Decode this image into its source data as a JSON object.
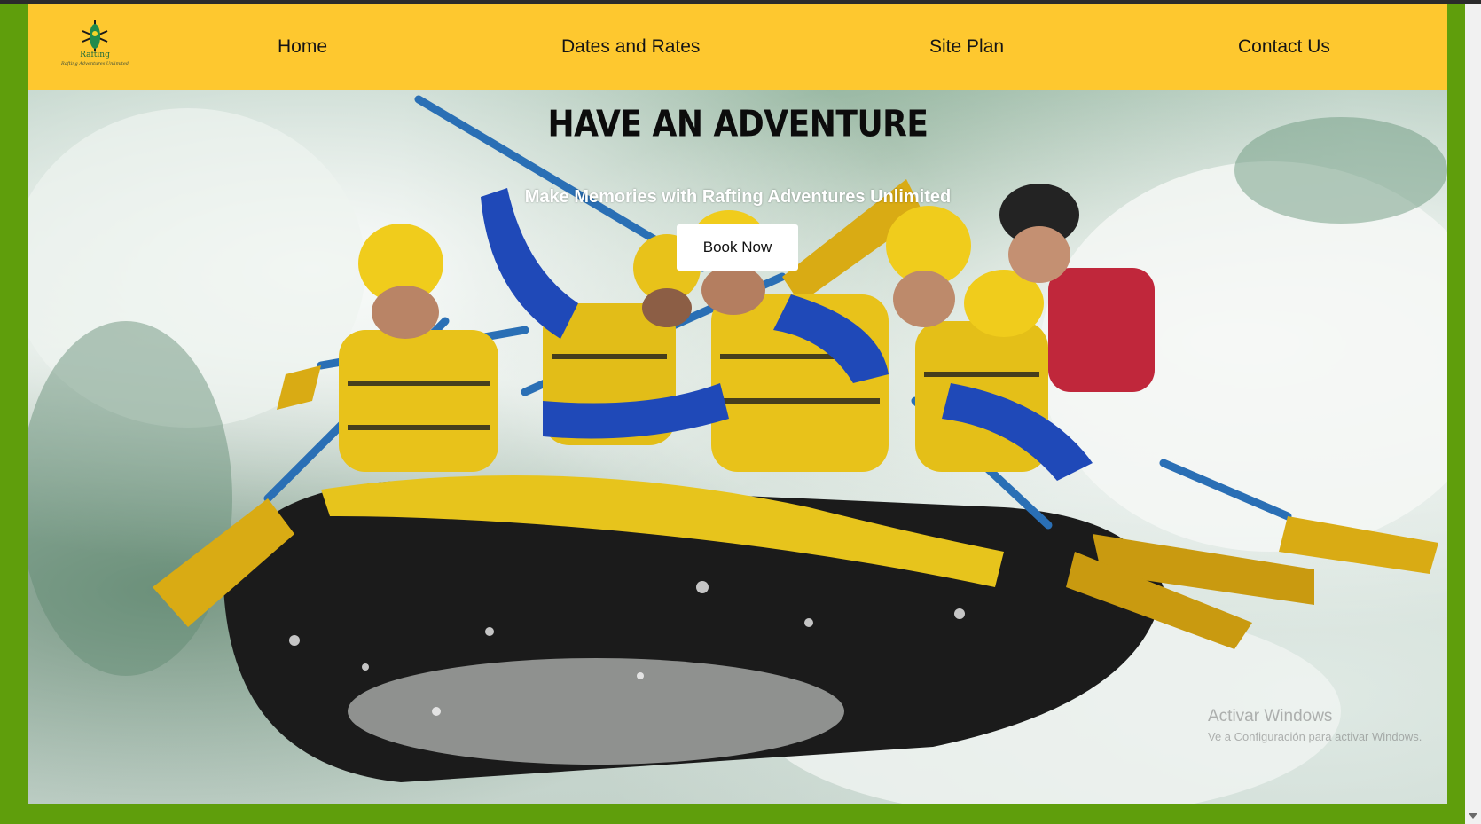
{
  "logo": {
    "title": "Rafting",
    "subtitle": "Rafting Adventures Unlimited"
  },
  "nav": {
    "items": [
      {
        "label": "Home"
      },
      {
        "label": "Dates and Rates"
      },
      {
        "label": "Site Plan"
      },
      {
        "label": "Contact Us"
      }
    ]
  },
  "hero": {
    "title": "HAVE AN ADVENTURE",
    "subtitle": "Make Memories with Rafting Adventures Unlimited",
    "button_label": "Book Now"
  },
  "watermark": {
    "line1": "Activar Windows",
    "line2": "Ve a Configuración para activar Windows."
  },
  "colors": {
    "nav_background": "#fec82f",
    "page_background": "#5f9e0c",
    "button_background": "#ffffff"
  }
}
